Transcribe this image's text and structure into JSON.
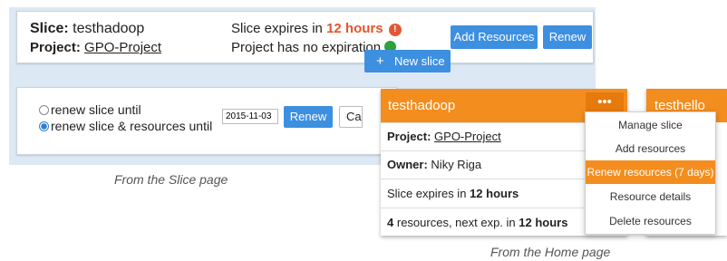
{
  "slice_page": {
    "slice_label": "Slice:",
    "slice_name": "testhadoop",
    "project_label": "Project:",
    "project_name": "GPO-Project",
    "expires_prefix": "Slice expires in",
    "expires_value": "12 hours",
    "project_expiration": "Project has no expiration",
    "add_resources_label": "Add Resources",
    "renew_label": "Renew",
    "renew_slice_option": "renew slice until",
    "renew_slice_resources_option": "renew slice & resources until",
    "selected_option": "renew slice & resources until",
    "renew_date": "2015-11-03",
    "renew_date_button": "Renew",
    "cancel_button": "Ca",
    "caption": "From the Slice page"
  },
  "new_slice_button": "New slice",
  "home_page": {
    "card_title": "testhadoop",
    "menu_icon": "•••",
    "project_label": "Project:",
    "project_name": "GPO-Project",
    "owner_label": "Owner:",
    "owner_name": "Niky Riga",
    "expires_prefix": "Slice expires in",
    "expires_value": "12 hours",
    "resources_count": "4",
    "resources_mid": "resources, next exp. in",
    "resources_exp": "12 hours",
    "second_card_title": "testhello",
    "menu_items": [
      "Manage slice",
      "Add resources",
      "Renew resources (7 days)",
      "Resource details",
      "Delete resources"
    ],
    "highlighted_item": "Renew resources (7 days)",
    "caption": "From the Home page"
  },
  "colors": {
    "accent_blue": "#3d8fe0",
    "accent_orange": "#f38d1e",
    "warning_red": "#e25734",
    "ok_green": "#2ea03c"
  },
  "icons": [
    "warning-icon",
    "check-icon",
    "plus-icon",
    "menu-dots-icon",
    "radio-icon"
  ]
}
